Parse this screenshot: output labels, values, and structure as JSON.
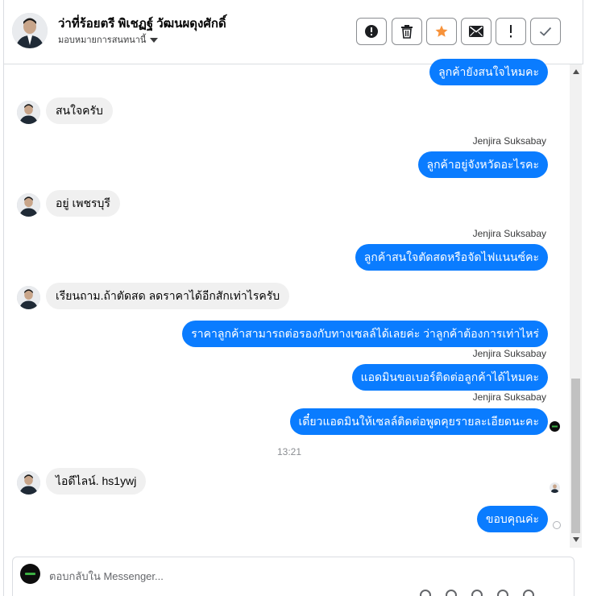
{
  "header": {
    "contact_name": "ว่าที่ร้อยตรี พิเชฏฐ์ วัฒนผดุงศักดิ์",
    "subtitle": "มอบหมายการสนทนานี้",
    "buttons": [
      {
        "icon": "alert-circle-icon"
      },
      {
        "icon": "trash-icon"
      },
      {
        "icon": "star-icon",
        "color": "#f7923a"
      },
      {
        "icon": "envelope-icon"
      },
      {
        "icon": "exclamation-icon"
      },
      {
        "icon": "check-icon"
      }
    ]
  },
  "messages": [
    {
      "direction": "out",
      "text": "ลูกค้ายังสนใจไหมคะ"
    },
    {
      "direction": "in",
      "text": "สนใจครับ"
    },
    {
      "direction": "out",
      "sender": "Jenjira Suksabay",
      "text": "ลูกค้าอยู่จังหวัดอะไรคะ"
    },
    {
      "direction": "in",
      "text": "อยู่ เพชรบุรี"
    },
    {
      "direction": "out",
      "sender": "Jenjira Suksabay",
      "text": "ลูกค้าสนใจตัดสดหรือจัดไฟแนนซ์คะ"
    },
    {
      "direction": "in",
      "text": "เรียนถาม.ถ้าตัดสด ลดราคาได้อีกสักเท่าไรครับ"
    },
    {
      "direction": "out",
      "text": "ราคาลูกค้าสามารถต่อรองกับทางเซลล์ได้เลยค่ะ ว่าลูกค้าต้องการเท่าไหร่"
    },
    {
      "direction": "out",
      "sender": "Jenjira Suksabay",
      "text": "แอดมินขอเบอร์ติดต่อลูกค้าได้ไหมคะ"
    },
    {
      "direction": "out",
      "sender": "Jenjira Suksabay",
      "text": "เดี๋ยวแอดมินให้เซลล์ติดต่อพูดคุยรายละเอียดนะคะ"
    },
    {
      "direction": "in",
      "text": "ไอดีไลน์.  hs1ywj"
    },
    {
      "direction": "out",
      "text": "ขอบคุณค่ะ"
    }
  ],
  "timestamp": "13:21",
  "composer": {
    "placeholder": "ตอบกลับใน Messenger..."
  },
  "colors": {
    "outgoing_bubble": "#0a7cff",
    "incoming_bubble": "#f0f0f0",
    "star": "#f7923a"
  }
}
